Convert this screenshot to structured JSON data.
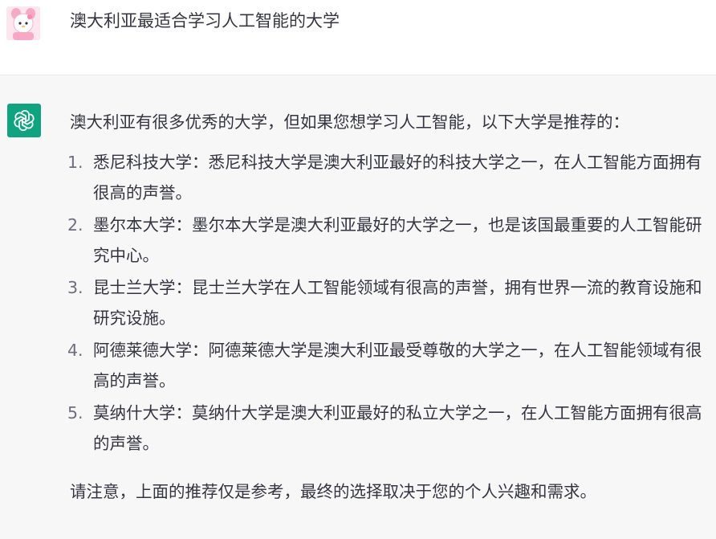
{
  "user_message": {
    "text": "澳大利亚最适合学习人工智能的大学"
  },
  "assistant_message": {
    "intro": "澳大利亚有很多优秀的大学，但如果您想学习人工智能，以下大学是推荐的：",
    "items": [
      {
        "number": "1.",
        "text": "悉尼科技大学：悉尼科技大学是澳大利亚最好的科技大学之一，在人工智能方面拥有很高的声誉。"
      },
      {
        "number": "2.",
        "text": "墨尔本大学：墨尔本大学是澳大利亚最好的大学之一，也是该国最重要的人工智能研究中心。"
      },
      {
        "number": "3.",
        "text": "昆士兰大学：昆士兰大学在人工智能领域有很高的声誉，拥有世界一流的教育设施和研究设施。"
      },
      {
        "number": "4.",
        "text": "阿德莱德大学：阿德莱德大学是澳大利亚最受尊敬的大学之一，在人工智能领域有很高的声誉。"
      },
      {
        "number": "5.",
        "text": "莫纳什大学：莫纳什大学是澳大利亚最好的私立大学之一，在人工智能方面拥有很高的声誉。"
      }
    ],
    "closing": "请注意，上面的推荐仅是参考，最终的选择取决于您的个人兴趣和需求。"
  },
  "colors": {
    "assistant_icon_bg": "#10a37f",
    "assistant_row_bg": "#f7f7f8",
    "user_avatar_bg": "#fde6ee"
  },
  "icons": {
    "user_avatar": "user-avatar-icon",
    "assistant_avatar": "openai-logo-icon"
  }
}
